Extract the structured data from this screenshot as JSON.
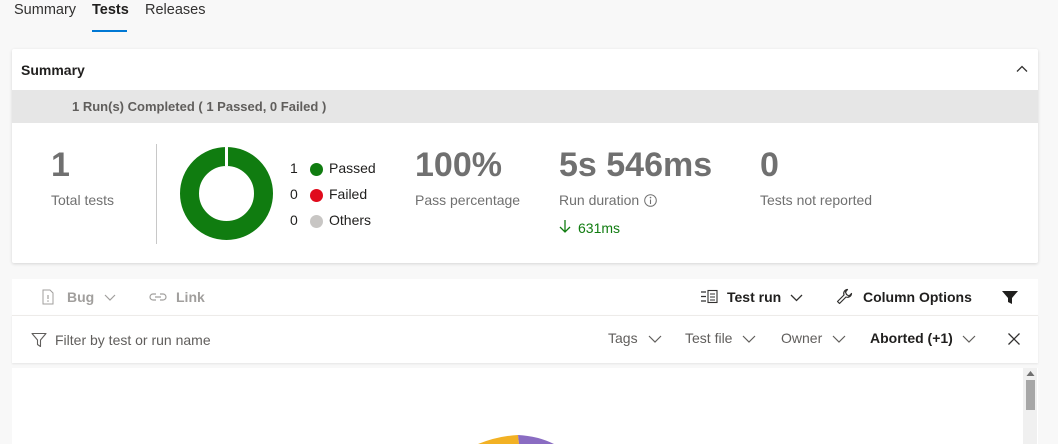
{
  "tabs": [
    {
      "label": "Summary"
    },
    {
      "label": "Tests"
    },
    {
      "label": "Releases"
    }
  ],
  "summary": {
    "title": "Summary",
    "banner": "1 Run(s) Completed ( 1 Passed, 0 Failed )",
    "total_tests": {
      "value": "1",
      "label": "Total tests"
    },
    "legend": [
      {
        "count": "1",
        "label": "Passed",
        "color": "#107c10"
      },
      {
        "count": "0",
        "label": "Failed",
        "color": "#e00b1c"
      },
      {
        "count": "0",
        "label": "Others",
        "color": "#c8c6c4"
      }
    ],
    "pass_percentage": {
      "value": "100%",
      "label": "Pass percentage"
    },
    "run_duration": {
      "value": "5s 546ms",
      "label": "Run duration",
      "delta": "631ms"
    },
    "not_reported": {
      "value": "0",
      "label": "Tests not reported"
    },
    "donut": {
      "passed_fraction": 1.0
    }
  },
  "toolbar": {
    "bug_label": "Bug",
    "link_label": "Link",
    "test_run_label": "Test run",
    "column_options_label": "Column Options"
  },
  "filterbar": {
    "placeholder": "Filter by test or run name",
    "tags_label": "Tags",
    "test_file_label": "Test file",
    "owner_label": "Owner",
    "outcome_label": "Aborted (+1)"
  },
  "colors": {
    "accent": "#0078d4",
    "passed": "#107c10",
    "failed": "#e00b1c",
    "others": "#c8c6c4"
  }
}
